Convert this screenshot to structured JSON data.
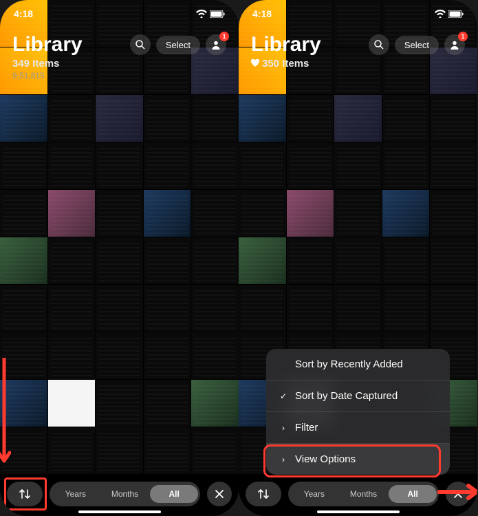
{
  "left": {
    "status": {
      "time": "4:18"
    },
    "header": {
      "title": "Library",
      "select_label": "Select",
      "items_label": "349 Items",
      "meta": "9,51,815",
      "badge": "1"
    },
    "bottom": {
      "seg": {
        "years": "Years",
        "months": "Months",
        "all": "All"
      }
    }
  },
  "right": {
    "status": {
      "time": "4:18"
    },
    "header": {
      "title": "Library",
      "select_label": "Select",
      "items_label": "350 Items",
      "badge": "1"
    },
    "popup": {
      "sort_recent": "Sort by Recently Added",
      "sort_date": "Sort by Date Captured",
      "filter": "Filter",
      "view_options": "View Options"
    },
    "bottom": {
      "seg": {
        "years": "Years",
        "months": "Months",
        "all": "All"
      }
    }
  }
}
